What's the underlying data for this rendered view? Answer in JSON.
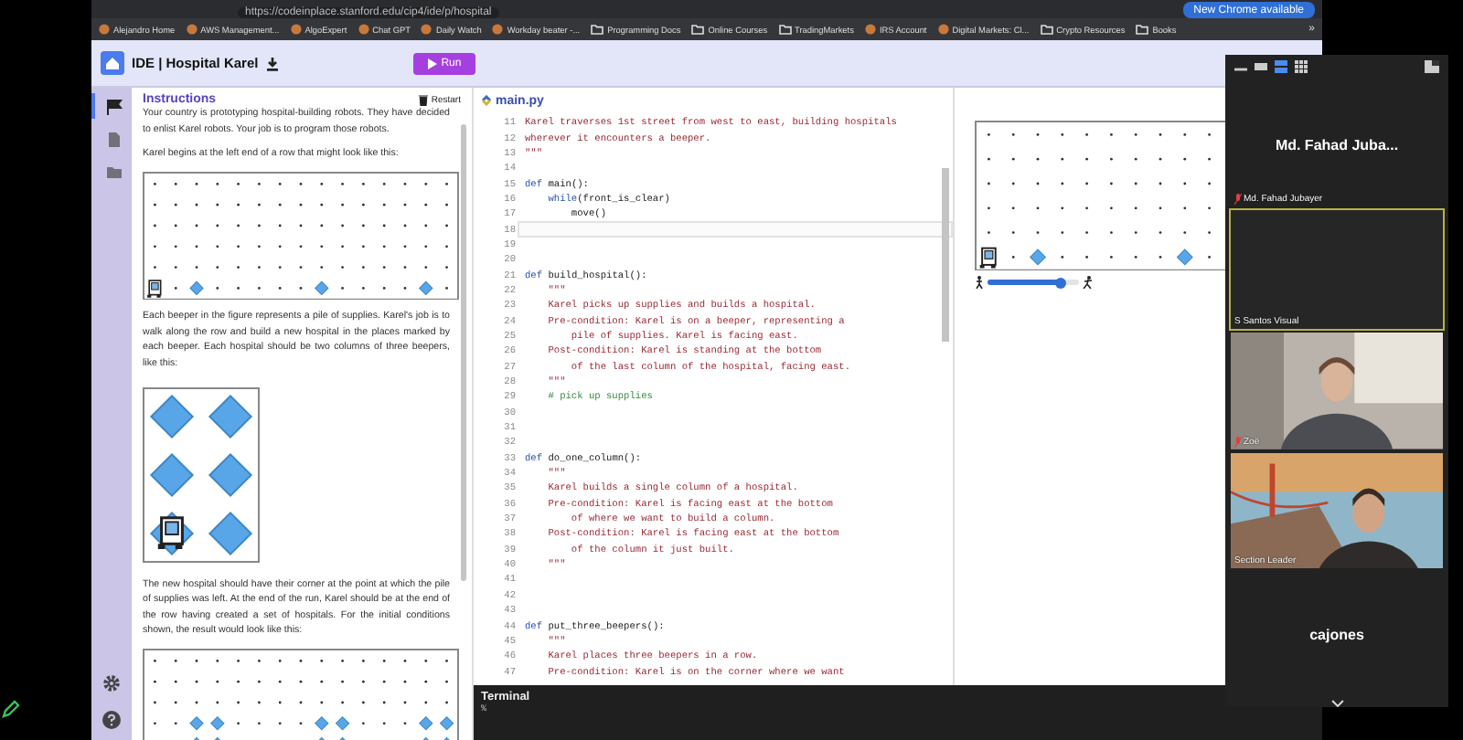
{
  "browser": {
    "url": "https://codeinplace.stanford.edu/cip4/ide/p/hospital",
    "update_button": "New Chrome available",
    "bookmarks": [
      {
        "kind": "site",
        "label": "Alejandro Home"
      },
      {
        "kind": "site",
        "label": "AWS Management..."
      },
      {
        "kind": "site",
        "label": "AlgoExpert"
      },
      {
        "kind": "site",
        "label": "Chat GPT"
      },
      {
        "kind": "site",
        "label": "Daily Watch"
      },
      {
        "kind": "site",
        "label": "Workday beater -..."
      },
      {
        "kind": "folder",
        "label": "Programming Docs"
      },
      {
        "kind": "folder",
        "label": "Online Courses"
      },
      {
        "kind": "folder",
        "label": "TradingMarkets"
      },
      {
        "kind": "site",
        "label": "IRS Account"
      },
      {
        "kind": "site",
        "label": "Digital Markets: Cl..."
      },
      {
        "kind": "folder",
        "label": "Crypto Resources"
      },
      {
        "kind": "folder",
        "label": "Books"
      },
      {
        "kind": "more",
        "label": "»"
      }
    ]
  },
  "ide": {
    "title": "IDE | Hospital Karel",
    "run_button": "Run"
  },
  "sidebar": {
    "items": [
      {
        "kind": "flag",
        "selected": true
      },
      {
        "kind": "file",
        "selected": false
      },
      {
        "kind": "folder",
        "selected": false
      }
    ],
    "bottom_items": [
      {
        "kind": "settings"
      },
      {
        "kind": "help"
      }
    ]
  },
  "instructions": {
    "title": "Instructions",
    "restart": "Restart",
    "blocks": [
      {
        "kind": "paragraph",
        "text": "Your country is prototyping hospital-building robots. They have decided to enlist Karel robots. Your job is to program those robots."
      },
      {
        "kind": "paragraph",
        "text": "Karel begins at the left end of a row that might look like this:"
      },
      {
        "kind": "world_start"
      },
      {
        "kind": "paragraph",
        "text": "Each beeper in the figure represents a pile of supplies. Karel's job is to walk along the row and build a new hospital in the places marked by each beeper. Each hospital should be two columns of three beepers, like this:"
      },
      {
        "kind": "hospital"
      },
      {
        "kind": "paragraph",
        "text": "The new hospital should have their corner at the point at which the pile of supplies was left. At the end of the run, Karel should be at the end of the row having created a set of hospitals. For the initial conditions shown, the result would look like this:"
      },
      {
        "kind": "world_result"
      }
    ]
  },
  "editor": {
    "filename": "main.py",
    "lines": [
      {
        "number": "11",
        "active": false,
        "tokens": [
          {
            "kind": "string",
            "text": "Karel traverses 1st street from west to east, building hospitals"
          }
        ]
      },
      {
        "number": "12",
        "active": false,
        "tokens": [
          {
            "kind": "string",
            "text": "wherever it encounters a beeper."
          }
        ]
      },
      {
        "number": "13",
        "active": false,
        "tokens": [
          {
            "kind": "string",
            "text": "\"\"\""
          }
        ]
      },
      {
        "number": "14",
        "active": false
      },
      {
        "number": "15",
        "active": false,
        "tokens": [
          {
            "kind": "keyword",
            "text": "def"
          },
          {
            "kind": "plain",
            "text": " main():"
          }
        ]
      },
      {
        "number": "16",
        "active": false,
        "tokens": [
          {
            "kind": "keyword",
            "text": "    while"
          },
          {
            "kind": "plain",
            "text": "(front_is_clear)"
          }
        ]
      },
      {
        "number": "17",
        "active": false,
        "tokens": [
          {
            "kind": "plain",
            "text": "        move()"
          }
        ]
      },
      {
        "number": "18",
        "active": true
      },
      {
        "number": "19",
        "active": false
      },
      {
        "number": "20",
        "active": false
      },
      {
        "number": "21",
        "active": false,
        "tokens": [
          {
            "kind": "keyword",
            "text": "def"
          },
          {
            "kind": "plain",
            "text": " build_hospital():"
          }
        ]
      },
      {
        "number": "22",
        "active": false,
        "tokens": [
          {
            "kind": "string",
            "text": "    \"\"\""
          }
        ]
      },
      {
        "number": "23",
        "active": false,
        "tokens": [
          {
            "kind": "string",
            "text": "    Karel picks up supplies and builds a hospital."
          }
        ]
      },
      {
        "number": "24",
        "active": false,
        "tokens": [
          {
            "kind": "string",
            "text": "    Pre-condition: Karel is on a beeper, representing a"
          }
        ]
      },
      {
        "number": "25",
        "active": false,
        "tokens": [
          {
            "kind": "string",
            "text": "        pile of supplies. Karel is facing east."
          }
        ]
      },
      {
        "number": "26",
        "active": false,
        "tokens": [
          {
            "kind": "string",
            "text": "    Post-condition: Karel is standing at the bottom"
          }
        ]
      },
      {
        "number": "27",
        "active": false,
        "tokens": [
          {
            "kind": "string",
            "text": "        of the last column of the hospital, facing east."
          }
        ]
      },
      {
        "number": "28",
        "active": false,
        "tokens": [
          {
            "kind": "string",
            "text": "    \"\"\""
          }
        ]
      },
      {
        "number": "29",
        "active": false,
        "tokens": [
          {
            "kind": "comment",
            "text": "    # pick up supplies"
          }
        ]
      },
      {
        "number": "30",
        "active": false
      },
      {
        "number": "31",
        "active": false
      },
      {
        "number": "32",
        "active": false
      },
      {
        "number": "33",
        "active": false,
        "tokens": [
          {
            "kind": "keyword",
            "text": "def"
          },
          {
            "kind": "plain",
            "text": " do_one_column():"
          }
        ]
      },
      {
        "number": "34",
        "active": false,
        "tokens": [
          {
            "kind": "string",
            "text": "    \"\"\""
          }
        ]
      },
      {
        "number": "35",
        "active": false,
        "tokens": [
          {
            "kind": "string",
            "text": "    Karel builds a single column of a hospital."
          }
        ]
      },
      {
        "number": "36",
        "active": false,
        "tokens": [
          {
            "kind": "string",
            "text": "    Pre-condition: Karel is facing east at the bottom"
          }
        ]
      },
      {
        "number": "37",
        "active": false,
        "tokens": [
          {
            "kind": "string",
            "text": "        of where we want to build a column."
          }
        ]
      },
      {
        "number": "38",
        "active": false,
        "tokens": [
          {
            "kind": "string",
            "text": "    Post-condition: Karel is facing east at the bottom"
          }
        ]
      },
      {
        "number": "39",
        "active": false,
        "tokens": [
          {
            "kind": "string",
            "text": "        of the column it just built."
          }
        ]
      },
      {
        "number": "40",
        "active": false,
        "tokens": [
          {
            "kind": "string",
            "text": "    \"\"\""
          }
        ]
      },
      {
        "number": "41",
        "active": false
      },
      {
        "number": "42",
        "active": false
      },
      {
        "number": "43",
        "active": false
      },
      {
        "number": "44",
        "active": false,
        "tokens": [
          {
            "kind": "keyword",
            "text": "def"
          },
          {
            "kind": "plain",
            "text": " put_three_beepers():"
          }
        ]
      },
      {
        "number": "45",
        "active": false,
        "tokens": [
          {
            "kind": "string",
            "text": "    \"\"\""
          }
        ]
      },
      {
        "number": "46",
        "active": false,
        "tokens": [
          {
            "kind": "string",
            "text": "    Karel places three beepers in a row."
          }
        ]
      },
      {
        "number": "47",
        "active": false,
        "tokens": [
          {
            "kind": "string",
            "text": "    Pre-condition: Karel is on the corner where we want"
          }
        ]
      }
    ]
  },
  "terminal": {
    "title": "Terminal",
    "prompt": "%"
  },
  "world": {
    "speed": {
      "level": 0.8
    }
  },
  "meeting": {
    "tiles": [
      {
        "kind": "name",
        "display": "Md. Fahad Juba...",
        "label": "Md. Fahad Jubayer",
        "muted": true,
        "speaking": false
      },
      {
        "kind": "blank",
        "label": "S Santos Visual",
        "muted": false,
        "speaking": true
      },
      {
        "kind": "video",
        "label": "Zoë",
        "muted": true,
        "speaking": false
      },
      {
        "kind": "video",
        "label": "Section Leader",
        "muted": false,
        "speaking": false
      },
      {
        "kind": "name",
        "display": "cajones",
        "speaking": false
      }
    ]
  }
}
